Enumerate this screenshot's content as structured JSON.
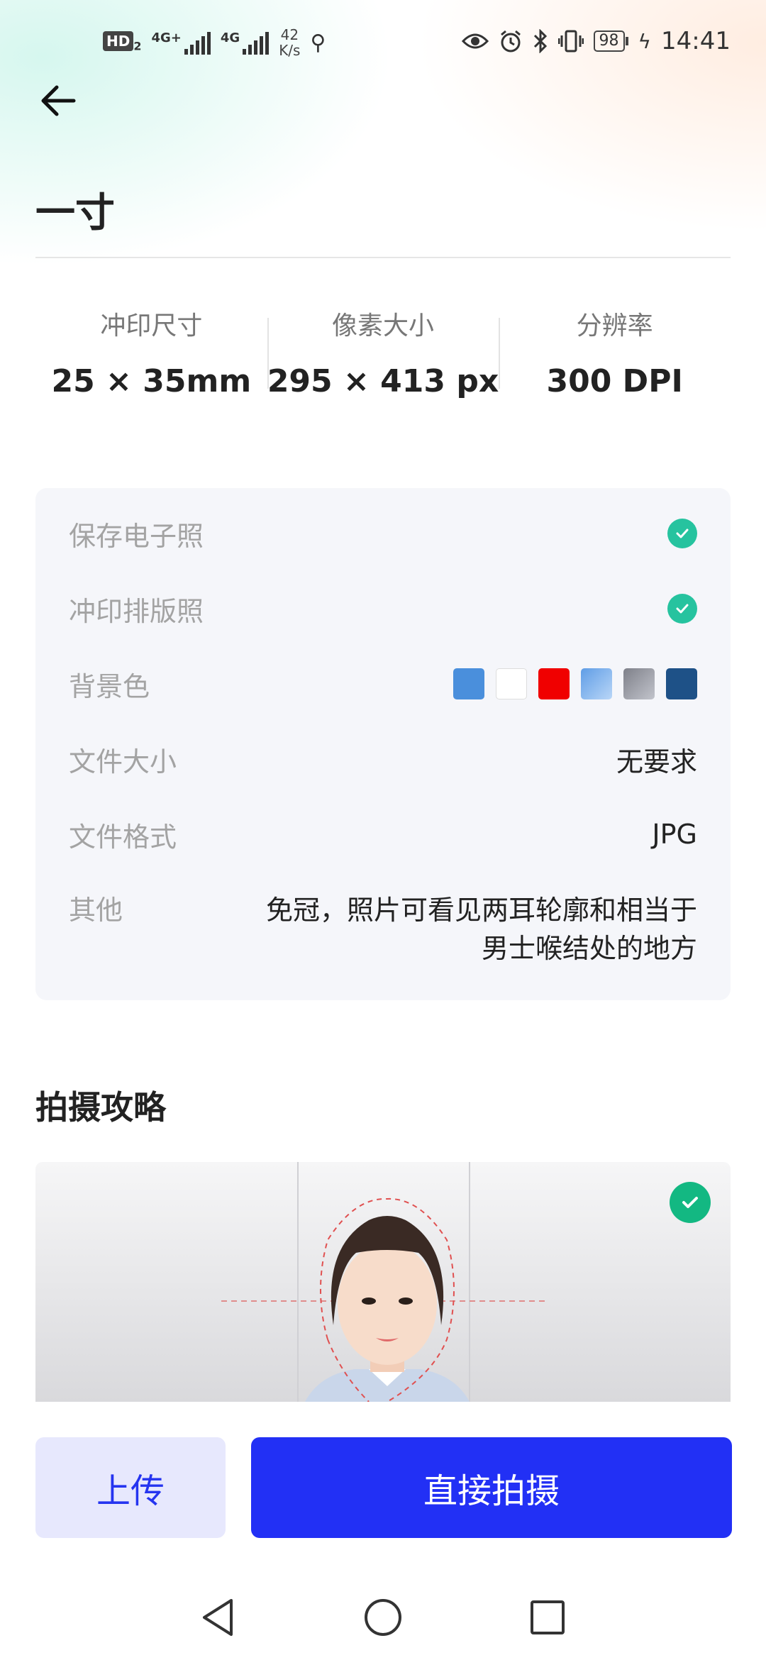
{
  "status_bar": {
    "hd_label": "HD",
    "hd_sub": "2",
    "sim1_label": "4G+",
    "sim2_label": "4G",
    "net_speed_value": "42",
    "net_speed_unit": "K/s",
    "battery": "98",
    "time": "14:41"
  },
  "header": {
    "title": "一寸"
  },
  "specs": [
    {
      "label": "冲印尺寸",
      "value": "25 × 35mm"
    },
    {
      "label": "像素大小",
      "value": "295 × 413 px"
    },
    {
      "label": "分辨率",
      "value": "300 DPI"
    }
  ],
  "details": {
    "save_electronic_label": "保存电子照",
    "print_layout_label": "冲印排版照",
    "background_label": "背景色",
    "background_colors": [
      "#4a8fdc",
      "#ffffff",
      "#f00000",
      "#7aaeea",
      "#8c8d97",
      "#1e5187"
    ],
    "file_size_label": "文件大小",
    "file_size_value": "无要求",
    "file_format_label": "文件格式",
    "file_format_value": "JPG",
    "other_label": "其他",
    "other_value": "免冠，照片可看见两耳轮廓和相当于男士喉结处的地方"
  },
  "guide": {
    "title": "拍摄攻略"
  },
  "actions": {
    "upload_label": "上传",
    "shoot_label": "直接拍摄"
  },
  "colors": {
    "accent": "#2230f5",
    "check_green": "#26c39f",
    "upload_bg": "#e7e8fd"
  },
  "icons": [
    "back-arrow-icon",
    "check-icon",
    "nav-back-icon",
    "nav-home-icon",
    "nav-recents-icon"
  ]
}
